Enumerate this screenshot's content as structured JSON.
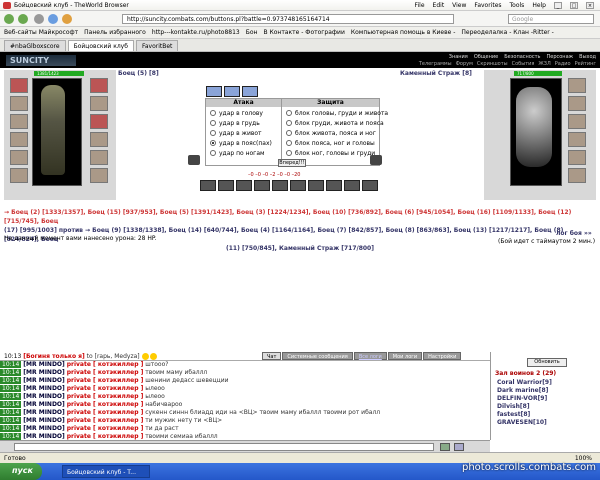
{
  "window": {
    "title": "Бойцовский клуб - TheWorld Browser",
    "menu": [
      "File",
      "Edit",
      "View",
      "Favorites",
      "Tools",
      "Help"
    ]
  },
  "address": {
    "url": "http://suncity.combats.com/buttons.pl?battle=0.973748165164714",
    "search_placeholder": "Google"
  },
  "favorites": [
    "Веб-сайты Майкрософт",
    "Панель избранного",
    "http---kontakte.ru/photo8813",
    "Бон",
    "В Контакте - Фотографии",
    "Компьютерная помощь в Киеве -",
    "Переоделалка - Клан -Ritter -"
  ],
  "tabs": [
    {
      "label": "#nbaGlboxscore",
      "active": false
    },
    {
      "label": "Бойцовский клуб",
      "active": true
    },
    {
      "label": "FavoritBet",
      "active": false
    }
  ],
  "header": {
    "logo": "SUNCITY",
    "links_top": [
      "Знания",
      "Общение",
      "Безопасность",
      "Персонаж",
      "Выход"
    ],
    "links_bottom": [
      "Телеграммы",
      "Форум",
      "Скриншоты",
      "События",
      "ЖЗЛ",
      "Радио",
      "Рейтинг"
    ]
  },
  "player": {
    "name": "Боец (5) [8]",
    "hp": "1381/1423"
  },
  "enemy": {
    "name": "Каменный Страж [8]",
    "hp": "717/800"
  },
  "battle": {
    "attack_header": "Атака",
    "defense_header": "Защита",
    "attack": [
      {
        "label": "удар в голову",
        "on": false
      },
      {
        "label": "удар в грудь",
        "on": false
      },
      {
        "label": "удар в живот",
        "on": false
      },
      {
        "label": "удар в пояс(пах)",
        "on": true
      },
      {
        "label": "удар по ногам",
        "on": false
      }
    ],
    "defense": [
      {
        "label": "блок головы, груди и живота",
        "on": false
      },
      {
        "label": "блок груди, живота и пояса",
        "on": false
      },
      {
        "label": "блок живота, пояса и ног",
        "on": false
      },
      {
        "label": "блок пояса, ног и головы",
        "on": false
      },
      {
        "label": "блок ног, головы и груди",
        "on": false
      }
    ],
    "forward": "Вперед!!!",
    "counters": "–0  –0  –0  –2  –0  –0  –20"
  },
  "fight": {
    "line1": "→ Боец (2) [1333/1357], Боец (15) [937/953], Боец (5) [1391/1423], Боец (3) [1224/1234], Боец (10) [736/892], Боец (6) [945/1054], Боец (16) [1109/1133], Боец (12) [715/745], Боец",
    "line2": "(17) [995/1003]  против  → Боец (9) [1338/1338], Боец (14) [640/744], Боец (4) [1164/1164], Боец (7) [842/857], Боец (8) [863/863], Боец (13) [1217/1217], Боец (8) [824/824], Боец",
    "line3": "(11) [750/845], Каменный Страж [717/800]",
    "damage": "На данный момент вами нанесено урона: 28 HP.",
    "log": "лог боя »»",
    "timeout": "(Бой идет с таймаутом 2 мин.)"
  },
  "chat": {
    "tabs": [
      {
        "label": "Чат",
        "active": true
      },
      {
        "label": "Системные сообщения",
        "active": false
      },
      {
        "label": "Все логи",
        "active": false
      },
      {
        "label": "Мои логи",
        "active": false
      },
      {
        "label": "Настройки",
        "active": false
      }
    ],
    "first": {
      "time": "10:13",
      "who": "[Богиня только я]",
      "msg": "to [rapь, Medyza]"
    },
    "lines": [
      {
        "time": "10:14",
        "who": "[MR MINDO]",
        "priv": "private [ котэкиллер ]",
        "msg": "штооо?"
      },
      {
        "time": "10:14",
        "who": "[MR MINDO]",
        "priv": "private [ котэкиллер ]",
        "msg": "твоим маму ибаллл"
      },
      {
        "time": "10:14",
        "who": "[MR MINDO]",
        "priv": "private [ котэкиллер ]",
        "msg": "шенини дедасс шевецции"
      },
      {
        "time": "10:14",
        "who": "[MR MINDO]",
        "priv": "private [ котэкиллер ]",
        "msg": "ылеоо"
      },
      {
        "time": "10:14",
        "who": "[MR MINDO]",
        "priv": "private [ котэкиллер ]",
        "msg": "ылеоо"
      },
      {
        "time": "10:14",
        "who": "[MR MINDO]",
        "priv": "private [ котэкиллер ]",
        "msg": "набичвароо"
      },
      {
        "time": "10:14",
        "who": "[MR MINDO]",
        "priv": "private [ котэкиллер ]",
        "msg": "сукенн синнн блиадд иди на <ВЦ> твоим маму ибаллл твоими рот ибалл"
      },
      {
        "time": "10:14",
        "who": "[MR MINDO]",
        "priv": "private [ котэкиллер ]",
        "msg": "ти мужик нету ти <ВЦ>"
      },
      {
        "time": "10:14",
        "who": "[MR MINDO]",
        "priv": "private [ котэкиллер ]",
        "msg": "ти да раст"
      },
      {
        "time": "10:14",
        "who": "[MR MINDO]",
        "priv": "private [ котэкиллер ]",
        "msg": "твоими семиаа ибаллл"
      }
    ]
  },
  "side": {
    "update": "Обновить",
    "title": "Зал воинов 2 (29)",
    "users": [
      "Coral Warrior[9]",
      "Dark marine[8]",
      "DELFIN-VOR[9]",
      "Dilvish[8]",
      "fastest[8]",
      "GRAVESEN[10]"
    ]
  },
  "status": {
    "text": "Готово",
    "zoom": "100%"
  },
  "taskbar": {
    "start": "пуск",
    "task": "Бойцовский клуб - T..."
  },
  "watermark": "photo.scrolls.combats.com"
}
